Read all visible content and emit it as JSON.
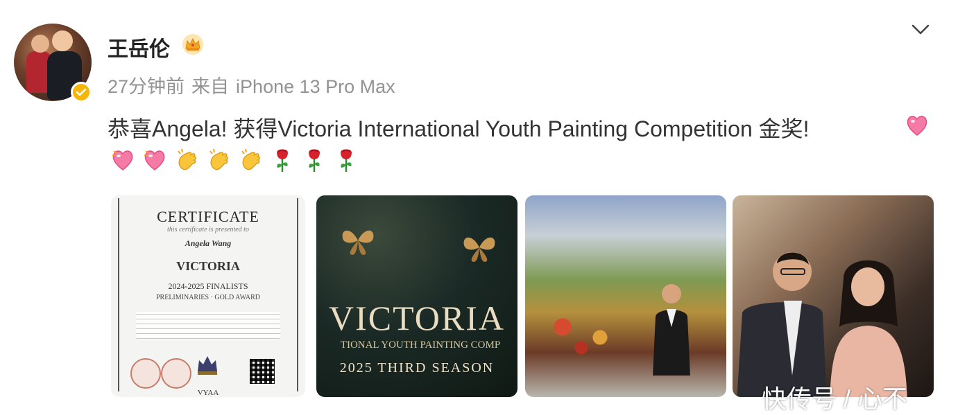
{
  "post": {
    "username": "王岳伦",
    "crown_icon": "crown-badge-icon",
    "verified_icon": "verified-badge-icon",
    "time": "27分钟前",
    "source_prefix": "来自",
    "source_device": "iPhone 13 Pro Max",
    "text": "恭喜Angela! 获得Victoria International Youth Painting Competition 金奖!",
    "inline_emoji": "heart-emoji",
    "emoji_row": [
      "heart-emoji",
      "heart-emoji",
      "clap-emoji",
      "clap-emoji",
      "clap-emoji",
      "rose-emoji",
      "rose-emoji",
      "rose-emoji"
    ]
  },
  "images": {
    "certificate": {
      "title": "CERTIFICATE",
      "subtitle": "this certificate is presented to",
      "name": "Angela Wang",
      "org": "VICTORIA",
      "line1": "2024-2025 FINALISTS",
      "line2": "PRELIMINARIES · GOLD AWARD",
      "footer": "VYAA"
    },
    "poster": {
      "title": "VICTORIA",
      "subtitle": "TIONAL YOUTH PAINTING COMP",
      "season": "2025 THIRD SEASON"
    }
  },
  "watermark": "快传号 / 心不",
  "colors": {
    "meta_gray": "#939393",
    "text": "#333333",
    "verified": "#f5b60a"
  }
}
